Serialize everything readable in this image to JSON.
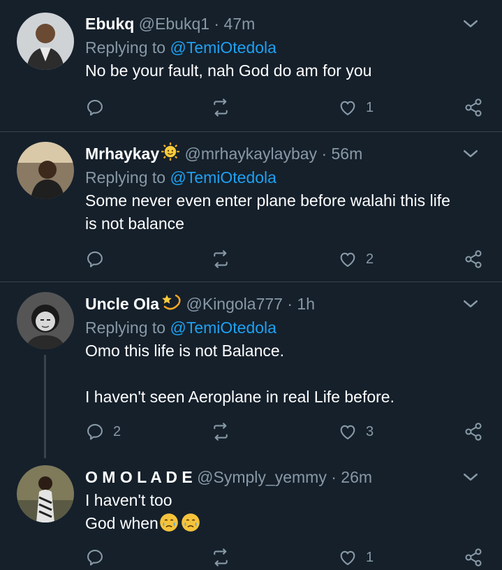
{
  "tweets": [
    {
      "name": "Ebukq",
      "handle": "@Ebukq1",
      "time": "47m",
      "replying_prefix": "Replying to",
      "replying_to": "@TemiOtedola",
      "lines": [
        "No be your fault, nah God do am for you"
      ],
      "reply_count": "",
      "like_count": "1"
    },
    {
      "name": "Mrhaykay",
      "name_emoji": "sun-with-face-emoji",
      "handle": "@mrhaykaylaybay",
      "time": "56m",
      "replying_prefix": "Replying to",
      "replying_to": "@TemiOtedola",
      "lines": [
        "Some never even enter plane before walahi this life",
        "is not balance"
      ],
      "reply_count": "",
      "like_count": "2"
    },
    {
      "name": "Uncle Ola",
      "name_emoji": "dizzy-emoji",
      "handle": "@Kingola777",
      "time": "1h",
      "replying_prefix": "Replying to",
      "replying_to": "@TemiOtedola",
      "lines": [
        "Omo this life is not Balance.",
        "",
        "I haven't seen Aeroplane in real Life before."
      ],
      "reply_count": "2",
      "like_count": "3"
    },
    {
      "name": "O M O L A D E",
      "handle": "@Symply_yemmy",
      "time": "26m",
      "lines": [
        "I haven't too",
        "God when"
      ],
      "line_emojis": [
        "crying-face-emoji",
        "crying-face-emoji"
      ],
      "reply_count": "",
      "like_count": "1"
    }
  ],
  "separator": "·",
  "colors": {
    "background": "#15202b",
    "secondary_text": "#8899a6",
    "link": "#1da1f2",
    "divider": "#38444d"
  }
}
